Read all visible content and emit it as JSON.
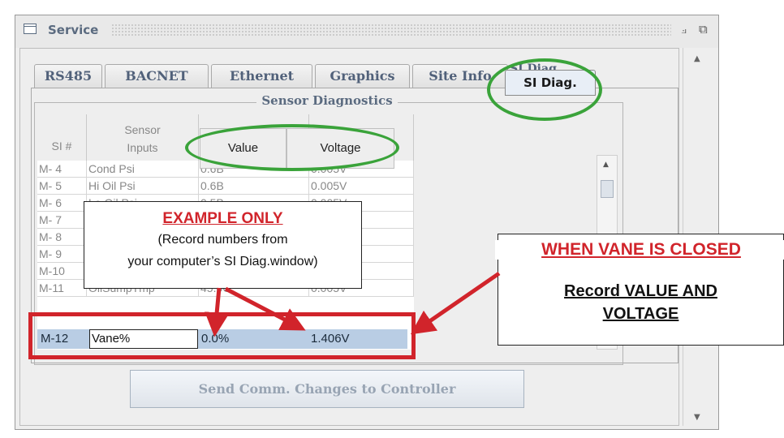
{
  "window": {
    "title": "Service",
    "minimize_glyph": "⟓",
    "maximize_glyph": "⧉"
  },
  "tabs": [
    {
      "label": "RS485"
    },
    {
      "label": "BACNET"
    },
    {
      "label": "Ethernet"
    },
    {
      "label": "Graphics"
    },
    {
      "label": "Site Info"
    }
  ],
  "active_tab": {
    "label": "SI Diag.",
    "peek_label": "SI Diag."
  },
  "panel": {
    "title": "Sensor Diagnostics"
  },
  "table": {
    "headers": {
      "si": "SI #",
      "sensor_line1": "Sensor",
      "sensor_line2": "Inputs",
      "value": "Value",
      "voltage": "Voltage"
    },
    "rows": [
      {
        "si": "M- 4",
        "input": "Cond Psi",
        "value": "0.6B",
        "voltage": "0.005V"
      },
      {
        "si": "M- 5",
        "input": "Hi Oil Psi",
        "value": "0.6B",
        "voltage": "0.005V"
      },
      {
        "si": "M- 6",
        "input": "Lo Oil Psi",
        "value": "0.5B",
        "voltage": "0.005V"
      },
      {
        "si": "M- 7",
        "input": "",
        "value": "",
        "voltage": ""
      },
      {
        "si": "M- 8",
        "input": "",
        "value": "",
        "voltage": ""
      },
      {
        "si": "M- 9",
        "input": "",
        "value": "",
        "voltage": ""
      },
      {
        "si": "M-10",
        "input": "",
        "value": "",
        "voltage": ""
      },
      {
        "si": "M-11",
        "input": "OilSumpTmp",
        "value": "45.0C",
        "voltage": "0.005V"
      }
    ],
    "selected_row": {
      "si": "M-12",
      "input": "Vane%",
      "value": "0.0%",
      "voltage": "1.406V"
    }
  },
  "send_button": {
    "label": "Send Comm. Changes to Controller"
  },
  "annotations": {
    "example_title": "EXAMPLE ONLY",
    "example_line1": "(Record numbers from",
    "example_line2": "your computer’s SI Diag.window)",
    "vane_title": "WHEN VANE IS CLOSED",
    "vane_line1": "Record VALUE AND",
    "vane_line2": "VOLTAGE",
    "highlight_color": "#d1242b",
    "oval_color": "#3aa33a"
  }
}
